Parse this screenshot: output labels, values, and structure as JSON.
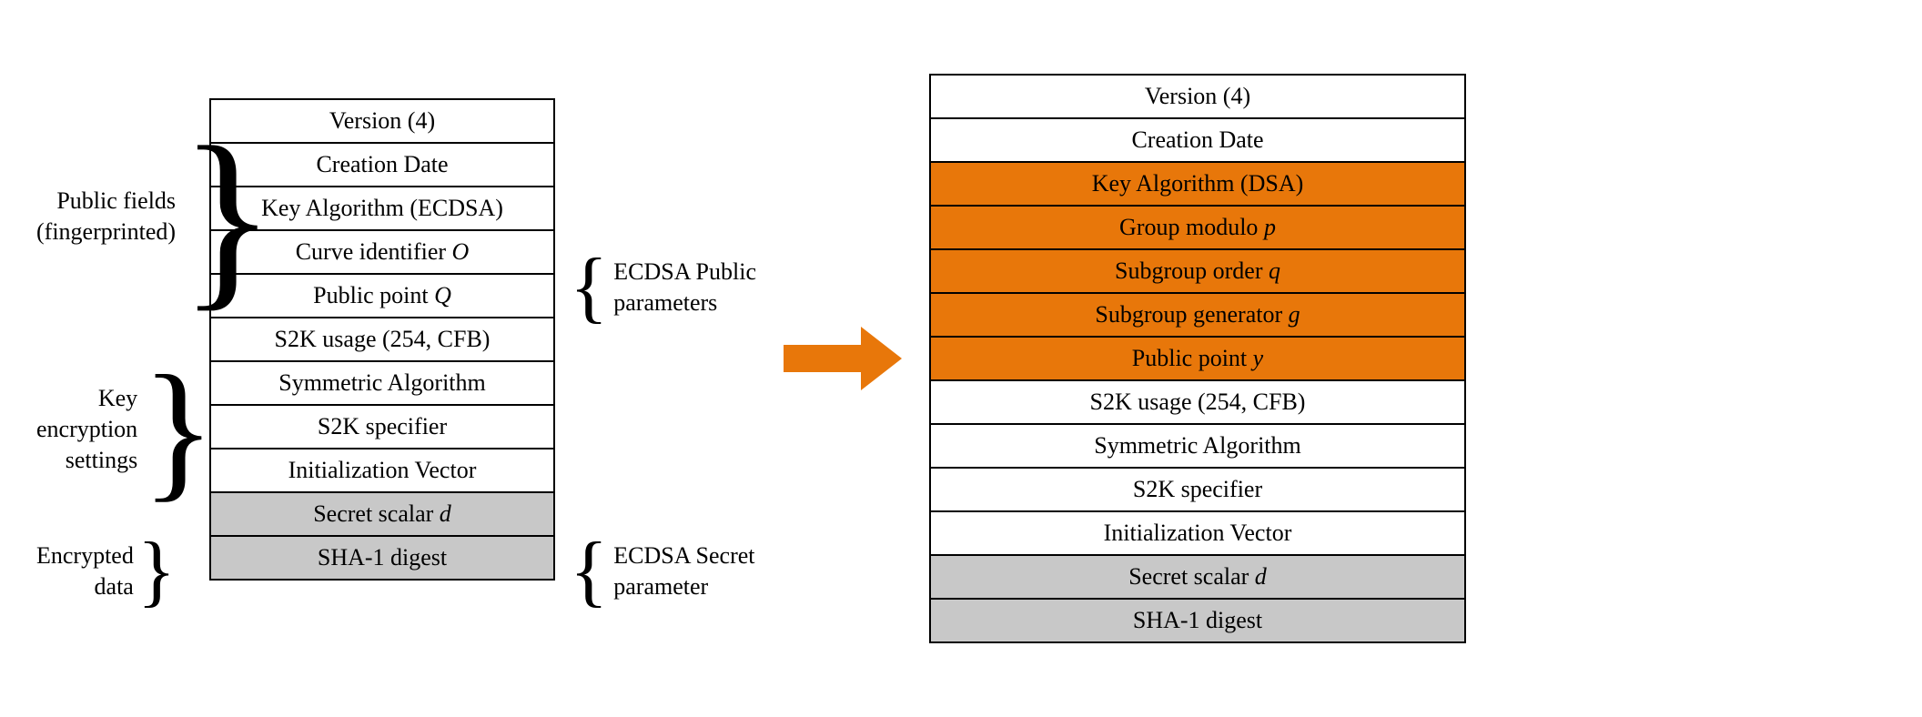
{
  "left_table": {
    "rows": [
      {
        "text": "Version (4)",
        "style": "normal"
      },
      {
        "text": "Creation Date",
        "style": "normal"
      },
      {
        "text": "Key Algorithm (ECDSA)",
        "style": "normal"
      },
      {
        "text": "Curve identifier O",
        "style": "normal",
        "has_italic": false
      },
      {
        "text": "Public point Q",
        "style": "normal",
        "has_italic": false
      },
      {
        "text": "S2K usage (254, CFB)",
        "style": "normal"
      },
      {
        "text": "Symmetric Algorithm",
        "style": "normal"
      },
      {
        "text": "S2K specifier",
        "style": "normal"
      },
      {
        "text": "Initialization Vector",
        "style": "normal"
      },
      {
        "text": "Secret scalar d",
        "style": "gray",
        "has_italic": false
      },
      {
        "text": "SHA-1 digest",
        "style": "gray"
      }
    ]
  },
  "left_annotations": [
    {
      "label": "Public fields\n(fingerprinted)",
      "rows": 5
    },
    {
      "label": "Key\nencryption\nsettings",
      "rows": 4
    },
    {
      "label": "Encrypted\ndata",
      "rows": 2
    }
  ],
  "right_annotations": [
    {
      "label": "ECDSA Public\nparameters",
      "rows": 5
    },
    {
      "label": "ECDSA Secret\nparameter",
      "rows": 2
    }
  ],
  "right_table": {
    "rows": [
      {
        "text": "Version (4)",
        "style": "normal"
      },
      {
        "text": "Creation Date",
        "style": "normal"
      },
      {
        "text": "Key Algorithm (DSA)",
        "style": "orange"
      },
      {
        "text": "Group modulo p",
        "style": "orange"
      },
      {
        "text": "Subgroup order q",
        "style": "orange"
      },
      {
        "text": "Subgroup generator g",
        "style": "orange"
      },
      {
        "text": "Public point y",
        "style": "orange"
      },
      {
        "text": "S2K usage (254, CFB)",
        "style": "normal"
      },
      {
        "text": "Symmetric Algorithm",
        "style": "normal"
      },
      {
        "text": "S2K specifier",
        "style": "normal"
      },
      {
        "text": "Initialization Vector",
        "style": "normal"
      },
      {
        "text": "Secret scalar d",
        "style": "gray"
      },
      {
        "text": "SHA-1 digest",
        "style": "gray"
      }
    ]
  },
  "arrow_color": "#E8770A"
}
